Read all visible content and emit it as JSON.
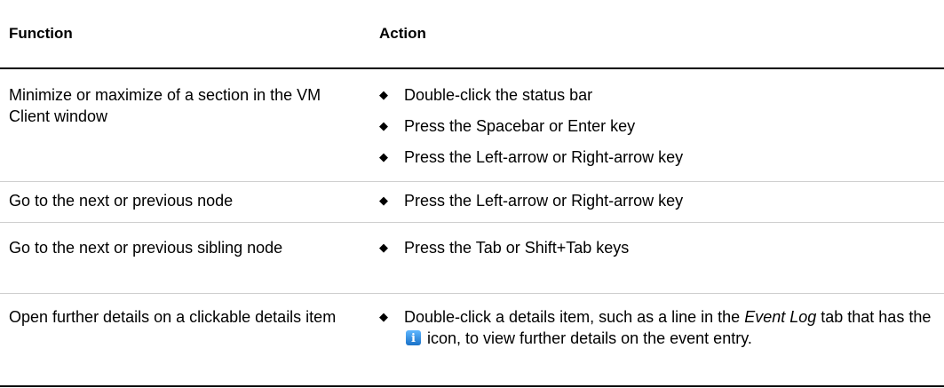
{
  "header": {
    "function": "Function",
    "action": "Action"
  },
  "bullet_glyph": "◆",
  "rows": [
    {
      "function": "Minimize or maximize of a section in the VM Client window",
      "actions": [
        "Double-click the status bar",
        "Press the Spacebar or Enter key",
        "Press the Left-arrow or Right-arrow key"
      ]
    },
    {
      "function": "Go to the next or previous node",
      "actions": [
        "Press the Left-arrow or Right-arrow key"
      ]
    },
    {
      "function": "Go to the next or previous sibling node",
      "actions": [
        "Press the Tab or Shift+Tab keys"
      ]
    },
    {
      "function": "Open further details on a clickable details item",
      "action_parts": {
        "t1": "Double-click a details item, such as a line in the ",
        "em1": "Event Log",
        "t2": " tab that has the ",
        "icon": "info-icon",
        "t3": " icon, to view further details on the event entry."
      }
    }
  ]
}
